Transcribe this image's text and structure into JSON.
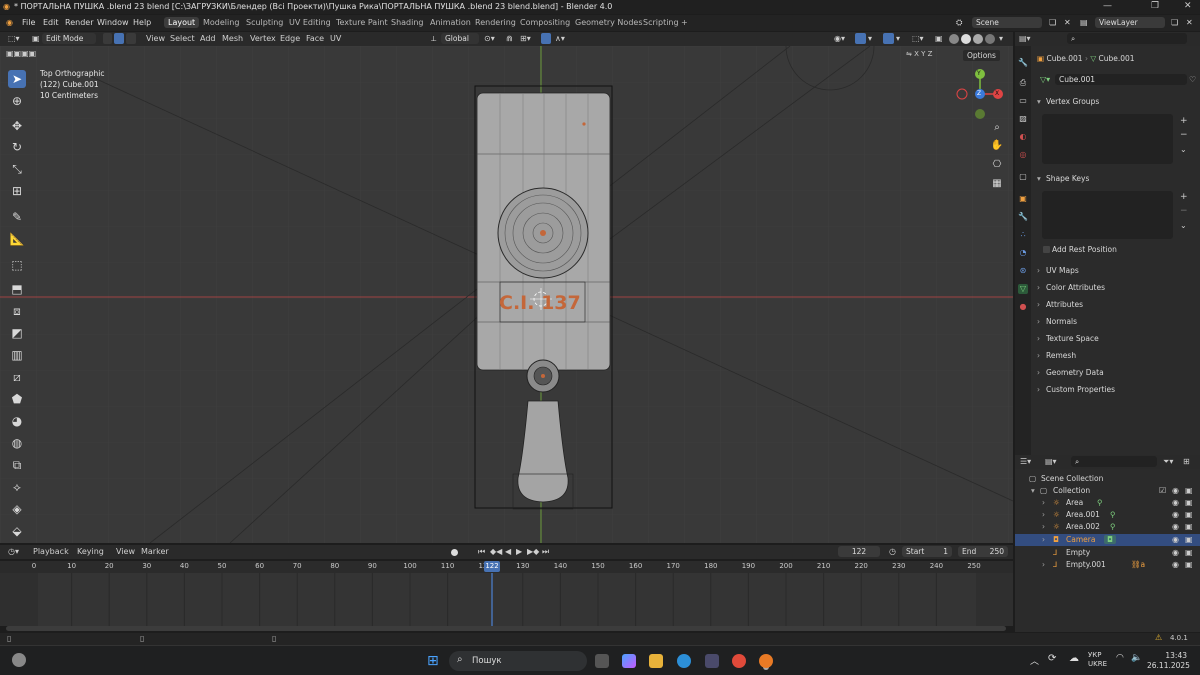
{
  "window": {
    "title": "* ПОРТАЛЬНА ПУШКА .blend 23 blend [C:\\ЗАГРУЗКИ\\Блендер (Всі Проекти)\\Пушка Рика\\ПОРТАЛЬНА ПУШКА .blend 23 blend.blend] - Blender 4.0"
  },
  "menus": [
    "File",
    "Edit",
    "Render",
    "Window",
    "Help"
  ],
  "workspaces": [
    "Layout",
    "Modeling",
    "Sculpting",
    "UV Editing",
    "Texture Paint",
    "Shading",
    "Animation",
    "Rendering",
    "Compositing",
    "Geometry Nodes",
    "Scripting"
  ],
  "workspace_add": "+",
  "scene": {
    "label": "Scene",
    "viewlayer": "ViewLayer"
  },
  "viewport_header": {
    "mode": "Edit Mode",
    "menus": [
      "View",
      "Select",
      "Add",
      "Mesh",
      "Vertex",
      "Edge",
      "Face",
      "UV"
    ],
    "orientation": "Global",
    "options_label": "Options",
    "axes": [
      "X",
      "Y",
      "Z"
    ]
  },
  "viewport_info": {
    "line1": "Top Orthographic",
    "line2": "(122) Cube.001",
    "line3": "10 Centimeters"
  },
  "model_decal": "C.I. 137",
  "gizmo": {
    "x": "X",
    "y": "Y",
    "z": "Z"
  },
  "properties": {
    "breadcrumb_object": "Cube.001",
    "breadcrumb_mesh": "Cube.001",
    "mesh_name": "Cube.001",
    "panels": {
      "vertex_groups": "Vertex Groups",
      "shape_keys": "Shape Keys",
      "add_rest_position": "Add Rest Position",
      "uv_maps": "UV Maps",
      "color_attributes": "Color Attributes",
      "attributes": "Attributes",
      "normals": "Normals",
      "texture_space": "Texture Space",
      "remesh": "Remesh",
      "geometry_data": "Geometry Data",
      "custom_properties": "Custom Properties"
    }
  },
  "outliner": {
    "scene_collection": "Scene Collection",
    "collection": "Collection",
    "items": [
      {
        "name": "Area"
      },
      {
        "name": "Area.001"
      },
      {
        "name": "Area.002"
      },
      {
        "name": "Camera"
      },
      {
        "name": "Empty"
      },
      {
        "name": "Empty.001"
      }
    ]
  },
  "timeline": {
    "menus": [
      "Playback",
      "Keying",
      "View",
      "Marker"
    ],
    "current_frame": "122",
    "start_label": "Start",
    "start": "1",
    "end_label": "End",
    "end": "250",
    "ticks": [
      "0",
      "10",
      "20",
      "30",
      "40",
      "50",
      "60",
      "70",
      "80",
      "90",
      "100",
      "110",
      "120",
      "130",
      "140",
      "150",
      "160",
      "170",
      "180",
      "190",
      "200",
      "210",
      "220",
      "230",
      "240",
      "250"
    ],
    "playhead": "122"
  },
  "statusbar": {
    "version": "4.0.1"
  },
  "taskbar": {
    "search_placeholder": "Пошук",
    "lang1": "УКР",
    "lang2": "UKRE",
    "time": "13:43",
    "date": "26.11.2025"
  }
}
